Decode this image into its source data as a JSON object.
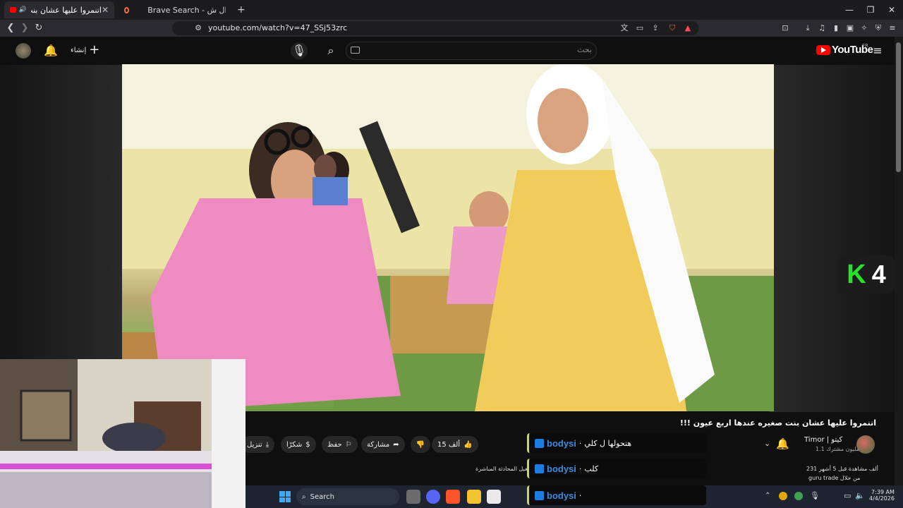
{
  "browser": {
    "tabs": [
      {
        "title": "اتنمروا عليها عشان بنت صغيره",
        "active": true
      },
      {
        "title": "Brave Search - يلد ب حرف ال ش",
        "active": false
      }
    ],
    "new_tab": "+",
    "url": "youtube.com/watch?v=47_SSj53zrc"
  },
  "youtube": {
    "create_label": "إنشاء",
    "search_placeholder": "بحث",
    "logo_text": "YouTube",
    "region": "FR"
  },
  "video": {
    "title": "اتنمروا عليها عشان بنت صغيره عندها اربع عيون !!!",
    "channel_name": "كيتو | Timor",
    "subscribers": "1.1 مليون مشترك",
    "likes": "15 ألف",
    "share_label": "مشاركة",
    "save_label": "حفظ",
    "thanks_label": "شكرًا",
    "download_label": "تنزيل",
    "description_views": "231 ألف مشاهدة قبل 5 أشهر",
    "description_line": "guru trade من خلال",
    "live_teaser": "تشغيل المحادثة المباشرة"
  },
  "overlay": {
    "k_letter": "K",
    "k_number": "4"
  },
  "chat": [
    {
      "user": "bodysi",
      "message": "هتحولها ل كلي"
    },
    {
      "user": "bodysi",
      "message": "كلب"
    },
    {
      "user": "bodysi",
      "message": ""
    }
  ],
  "taskbar": {
    "search_label": "Search",
    "time": "7:39 AM",
    "date": "4/4/2026"
  },
  "colors": {
    "youtube_red": "#ff0000",
    "k_green": "#29e02a",
    "chat_user": "#3b8de3",
    "chat_accent": "#c8d85a"
  }
}
